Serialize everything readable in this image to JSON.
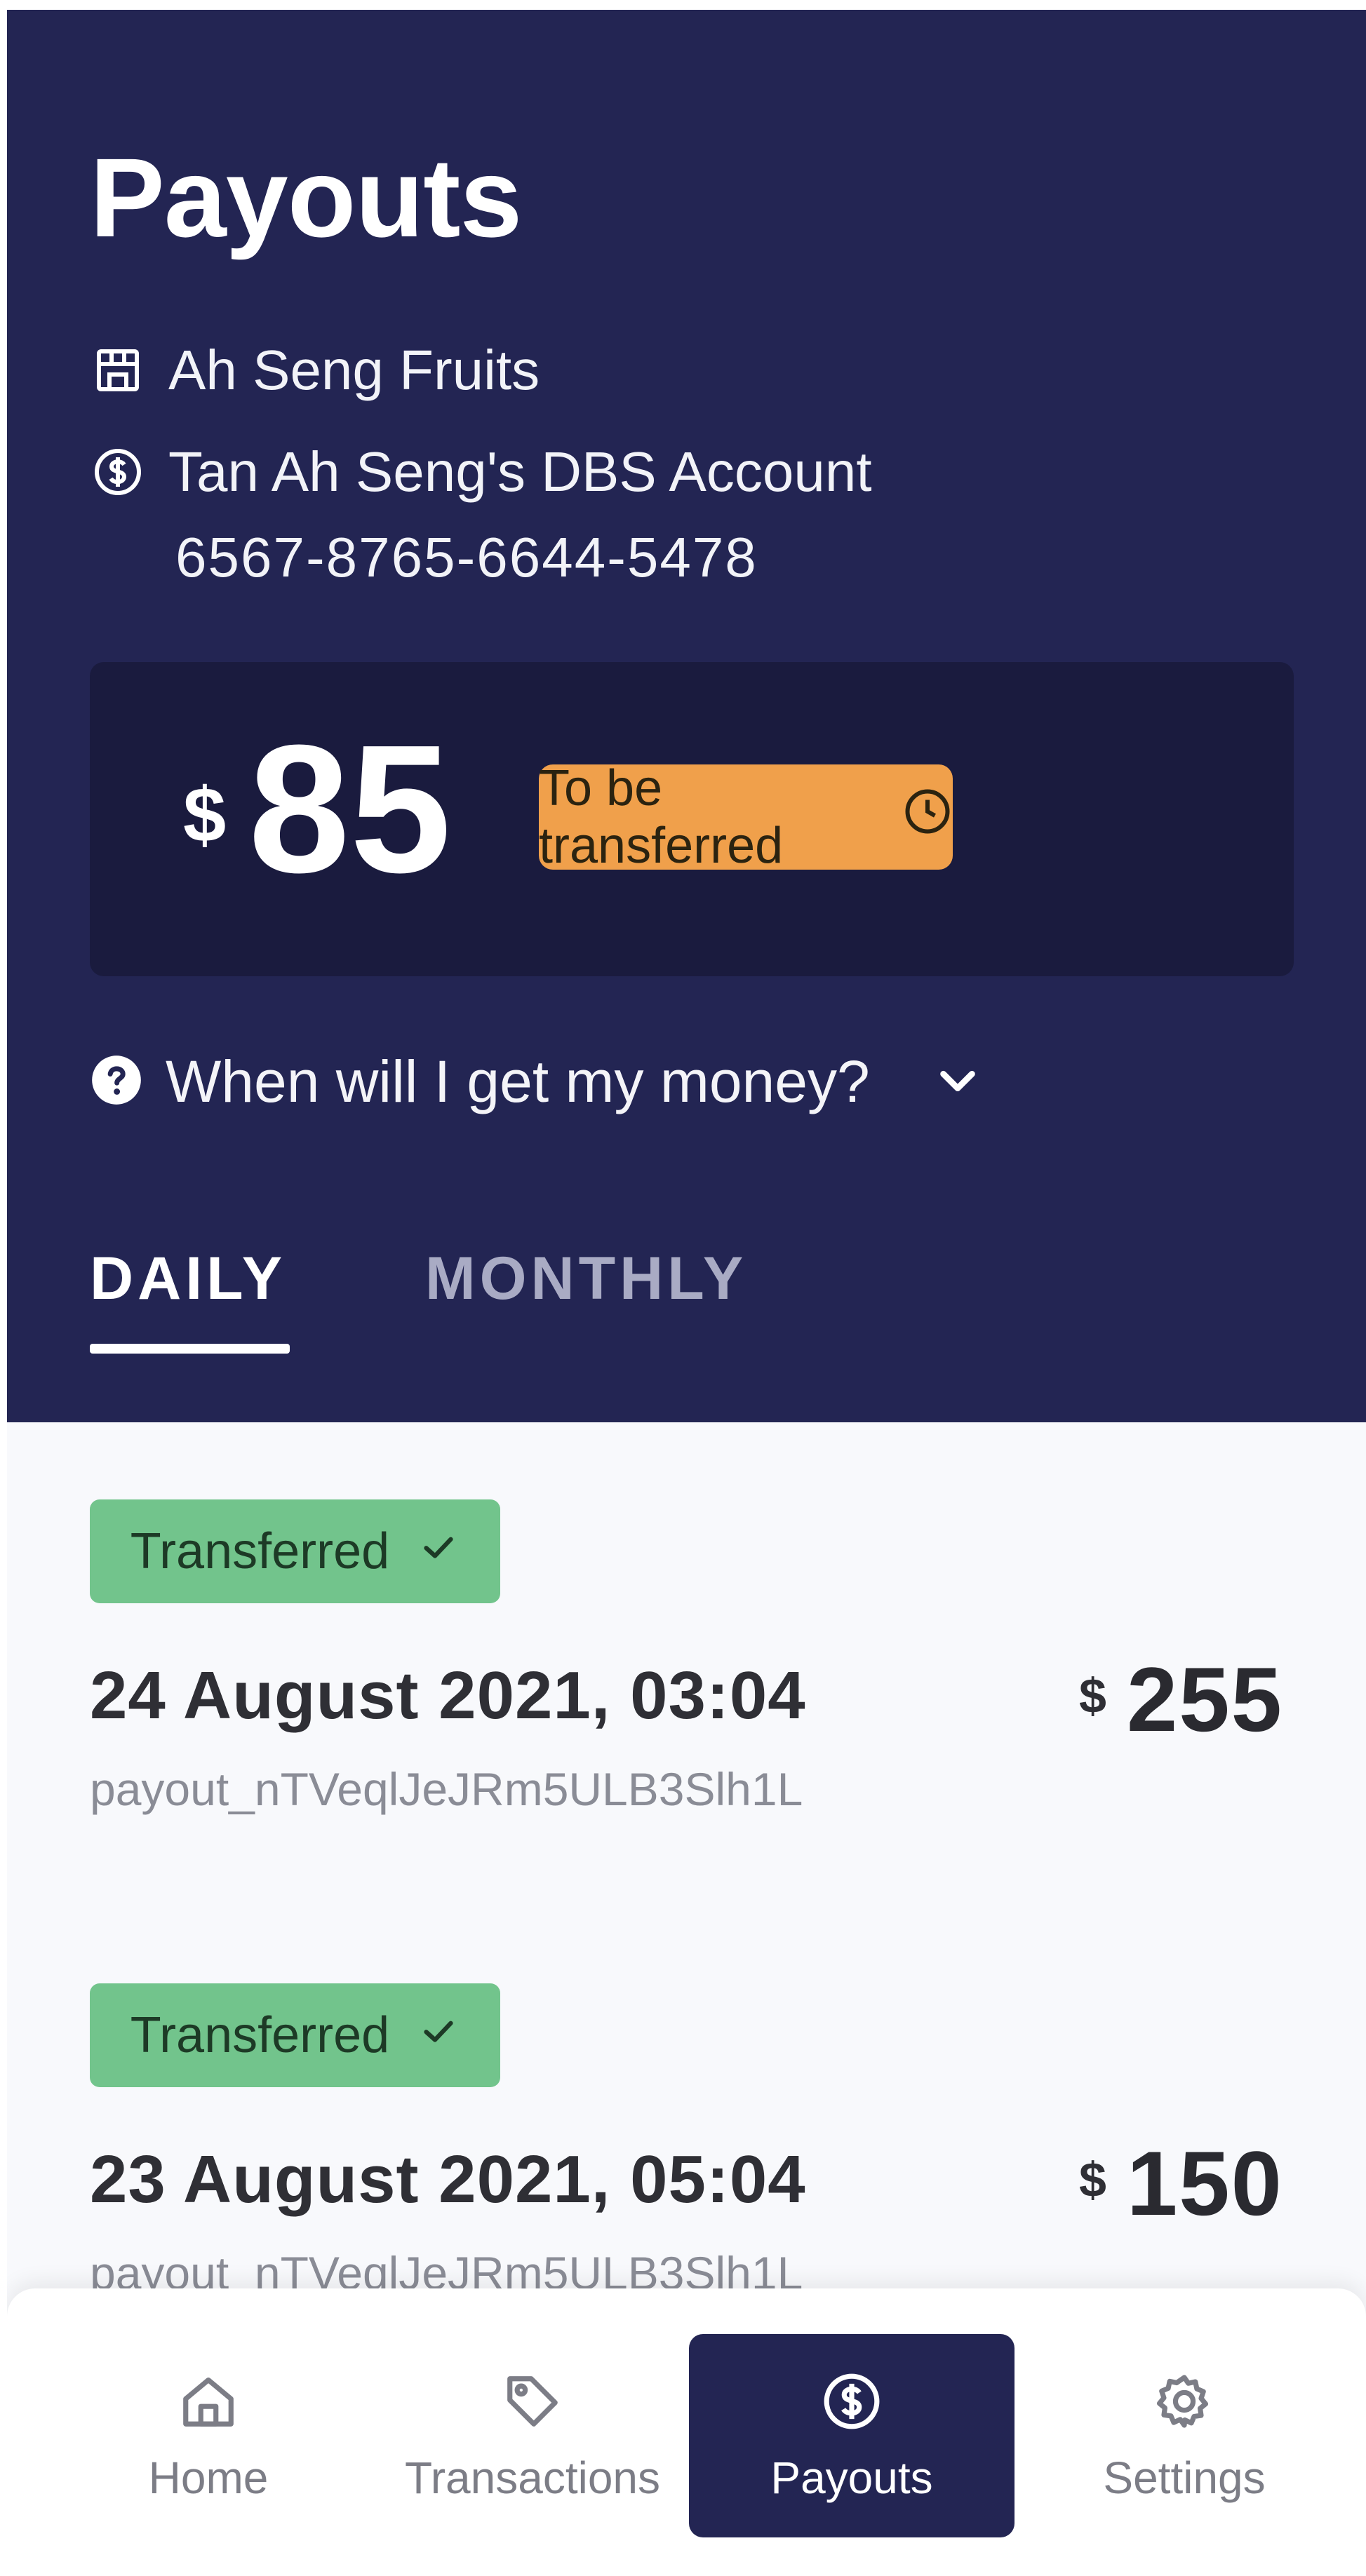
{
  "header": {
    "title": "Payouts",
    "shop_name": "Ah Seng Fruits",
    "bank_account_name": "Tan Ah Seng's DBS Account",
    "bank_account_number": "6567-8765-6644-5478"
  },
  "balance": {
    "currency": "$",
    "amount": "85",
    "status": "To be transferred"
  },
  "faq": {
    "question": "When will I get my money?"
  },
  "tabs": [
    {
      "label": "DAILY",
      "active": true
    },
    {
      "label": "MONTHLY",
      "active": false
    }
  ],
  "payouts": [
    {
      "status": "Transferred",
      "date": "24 August 2021, 03:04",
      "currency": "$",
      "amount": "255",
      "id": "payout_nTVeqlJeJRm5ULB3Slh1L"
    },
    {
      "status": "Transferred",
      "date": "23 August 2021, 05:04",
      "currency": "$",
      "amount": "150",
      "id": "payout_nTVeqlJeJRm5ULB3Slh1L"
    }
  ],
  "bottom_nav": [
    {
      "label": "Home",
      "icon": "home-icon",
      "active": false
    },
    {
      "label": "Transactions",
      "icon": "tag-icon",
      "active": false
    },
    {
      "label": "Payouts",
      "icon": "dollar-circle-icon",
      "active": true
    },
    {
      "label": "Settings",
      "icon": "gear-icon",
      "active": false
    }
  ],
  "colors": {
    "header_bg": "#232553",
    "balance_card_bg": "#1a1b3e",
    "pending_badge": "#f0a04b",
    "transferred_badge": "#72c48c",
    "content_bg": "#f8f9fc"
  }
}
